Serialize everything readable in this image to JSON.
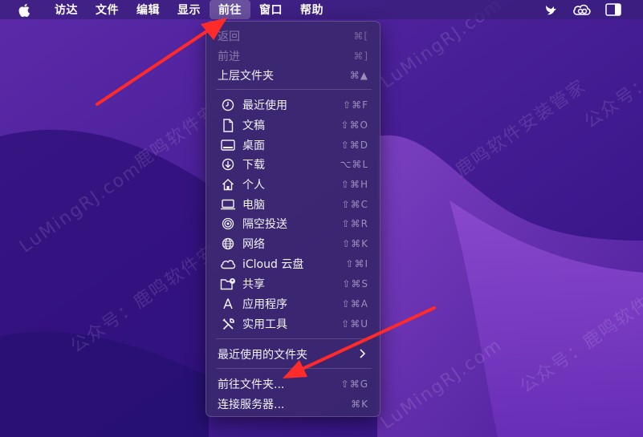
{
  "menubar": {
    "apple_icon": "apple-logo-icon",
    "items": [
      {
        "label": "访达"
      },
      {
        "label": "文件"
      },
      {
        "label": "编辑"
      },
      {
        "label": "显示"
      },
      {
        "label": "前往",
        "active": true
      },
      {
        "label": "窗口"
      },
      {
        "label": "帮助"
      }
    ],
    "status_icons": [
      "bird-icon",
      "creative-cloud-icon",
      "sidebar-icon"
    ]
  },
  "go_menu": {
    "back": {
      "label": "返回",
      "shortcut": "⌘[",
      "enabled": false
    },
    "forward": {
      "label": "前进",
      "shortcut": "⌘]",
      "enabled": false
    },
    "enclosing": {
      "label": "上层文件夹",
      "shortcut": "⌘▲",
      "enabled": true
    },
    "places": [
      {
        "label": "最近使用",
        "shortcut": "⇧⌘F",
        "icon": "clock-icon"
      },
      {
        "label": "文稿",
        "shortcut": "⇧⌘O",
        "icon": "document-icon"
      },
      {
        "label": "桌面",
        "shortcut": "⇧⌘D",
        "icon": "desktop-icon"
      },
      {
        "label": "下载",
        "shortcut": "⌥⌘L",
        "icon": "download-icon"
      },
      {
        "label": "个人",
        "shortcut": "⇧⌘H",
        "icon": "home-icon"
      },
      {
        "label": "电脑",
        "shortcut": "⇧⌘C",
        "icon": "laptop-icon"
      },
      {
        "label": "隔空投送",
        "shortcut": "⇧⌘R",
        "icon": "airdrop-icon"
      },
      {
        "label": "网络",
        "shortcut": "⇧⌘K",
        "icon": "globe-icon"
      },
      {
        "label": "iCloud 云盘",
        "shortcut": "⇧⌘I",
        "icon": "icloud-icon"
      },
      {
        "label": "共享",
        "shortcut": "⇧⌘S",
        "icon": "shared-folder-icon"
      },
      {
        "label": "应用程序",
        "shortcut": "⇧⌘A",
        "icon": "applications-icon"
      },
      {
        "label": "实用工具",
        "shortcut": "⇧⌘U",
        "icon": "utilities-icon"
      }
    ],
    "recent_folders": {
      "label": "最近使用的文件夹"
    },
    "go_to_folder": {
      "label": "前往文件夹...",
      "shortcut": "⇧⌘G"
    },
    "connect_server": {
      "label": "连接服务器...",
      "shortcut": "⌘K"
    }
  },
  "watermark": {
    "brand": "鹿鸣软件安装管家",
    "account": "公众号：",
    "site": "LuMingRJ.com"
  },
  "colors": {
    "menubar_bg": "#371e78",
    "menu_bg": "#3a286e",
    "arrow": "#ff2a2a"
  }
}
